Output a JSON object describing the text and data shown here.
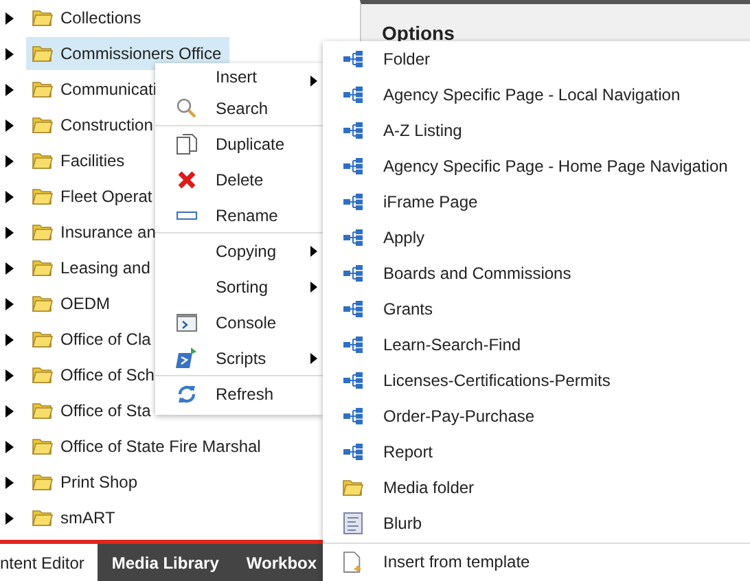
{
  "tree": [
    {
      "label": "Collections",
      "selected": false
    },
    {
      "label": "Commissioners Office",
      "selected": true
    },
    {
      "label": "Communicati",
      "selected": false
    },
    {
      "label": "Construction",
      "selected": false
    },
    {
      "label": "Facilities",
      "selected": false
    },
    {
      "label": "Fleet Operat",
      "selected": false
    },
    {
      "label": "Insurance an",
      "selected": false
    },
    {
      "label": "Leasing and",
      "selected": false
    },
    {
      "label": "OEDM",
      "selected": false
    },
    {
      "label": "Office of Cla",
      "selected": false
    },
    {
      "label": "Office of Sch",
      "selected": false
    },
    {
      "label": "Office of Sta",
      "selected": false
    },
    {
      "label": "Office of State Fire Marshal",
      "selected": false
    },
    {
      "label": "Print Shop",
      "selected": false
    },
    {
      "label": "smART",
      "selected": false
    }
  ],
  "tabs": [
    {
      "label": "ntent Editor",
      "selected": true
    },
    {
      "label": "Media Library",
      "selected": false
    },
    {
      "label": "Workbox",
      "selected": false
    }
  ],
  "panel": {
    "title": "Options"
  },
  "context_menu": [
    {
      "label": "Insert",
      "kind": "plain",
      "submenu": true,
      "divider_after": false
    },
    {
      "label": "Search",
      "kind": "search",
      "submenu": false,
      "divider_after": true
    },
    {
      "label": "Duplicate",
      "kind": "duplicate",
      "submenu": false,
      "divider_after": false
    },
    {
      "label": "Delete",
      "kind": "delete",
      "submenu": false,
      "divider_after": false
    },
    {
      "label": "Rename",
      "kind": "rename",
      "submenu": false,
      "divider_after": true
    },
    {
      "label": "Copying",
      "kind": "plain",
      "submenu": true,
      "divider_after": false
    },
    {
      "label": "Sorting",
      "kind": "plain",
      "submenu": true,
      "divider_after": false
    },
    {
      "label": "Console",
      "kind": "console",
      "submenu": false,
      "divider_after": false
    },
    {
      "label": "Scripts",
      "kind": "scripts",
      "submenu": true,
      "divider_after": true
    },
    {
      "label": "Refresh",
      "kind": "refresh",
      "submenu": false,
      "divider_after": false
    }
  ],
  "submenu": [
    {
      "label": "Folder",
      "kind": "item"
    },
    {
      "label": "Agency Specific Page - Local Navigation",
      "kind": "item"
    },
    {
      "label": "A-Z Listing",
      "kind": "item"
    },
    {
      "label": "Agency Specific Page - Home Page Navigation",
      "kind": "item"
    },
    {
      "label": "iFrame Page",
      "kind": "item"
    },
    {
      "label": "Apply",
      "kind": "item"
    },
    {
      "label": "Boards and Commissions",
      "kind": "item"
    },
    {
      "label": "Grants",
      "kind": "item"
    },
    {
      "label": "Learn-Search-Find",
      "kind": "item"
    },
    {
      "label": "Licenses-Certifications-Permits",
      "kind": "item"
    },
    {
      "label": "Order-Pay-Purchase",
      "kind": "item"
    },
    {
      "label": "Report",
      "kind": "item"
    },
    {
      "label": "Media folder",
      "kind": "folder"
    },
    {
      "label": "Blurb",
      "kind": "blurb"
    },
    {
      "label": "Insert from template",
      "kind": "template"
    }
  ]
}
